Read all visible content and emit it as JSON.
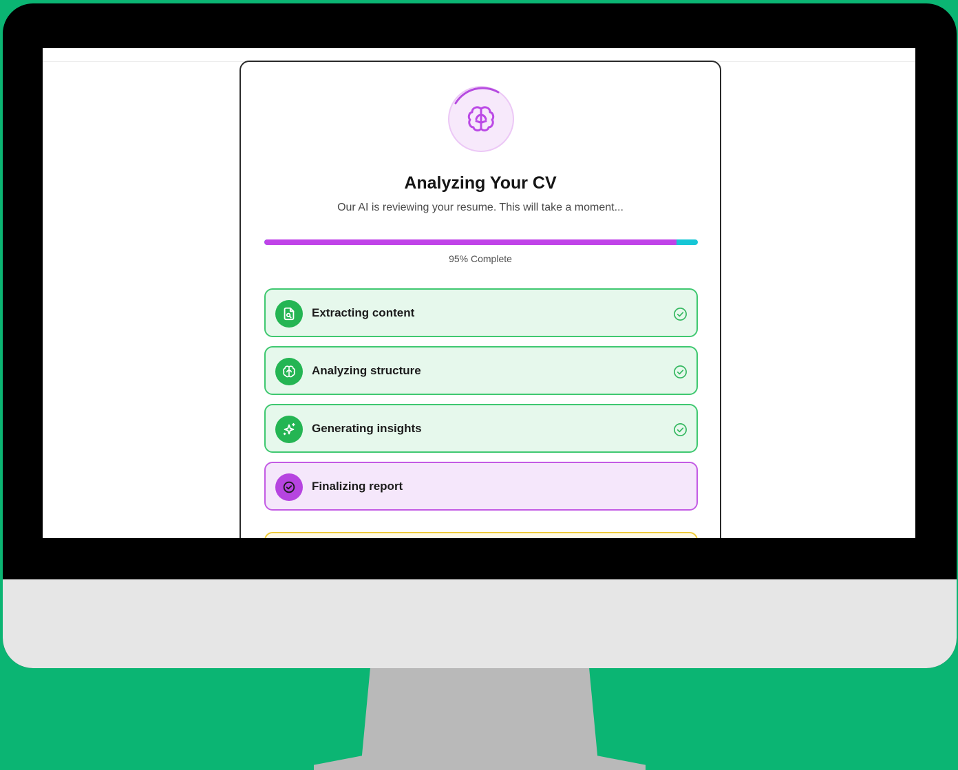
{
  "header": {
    "title": "Analyzing Your CV",
    "subtitle": "Our AI is reviewing your resume. This will take a moment..."
  },
  "progress": {
    "value": 0.95,
    "label": "95% Complete"
  },
  "steps": [
    {
      "label": "Extracting content",
      "icon": "document-search-icon",
      "status": "done"
    },
    {
      "label": "Analyzing structure",
      "icon": "brain-icon",
      "status": "done"
    },
    {
      "label": "Generating insights",
      "icon": "sparkles-icon",
      "status": "done"
    },
    {
      "label": "Finalizing report",
      "icon": "circle-check-icon",
      "status": "active"
    }
  ],
  "colors": {
    "background": "#0bb573",
    "accent": "#c043e8",
    "progress_remainder": "#16c6d6",
    "success": "#24b553",
    "success_bg": "#e6f8ec",
    "active_bg": "#f5e7fb",
    "pending_border": "#f0cc3a"
  }
}
